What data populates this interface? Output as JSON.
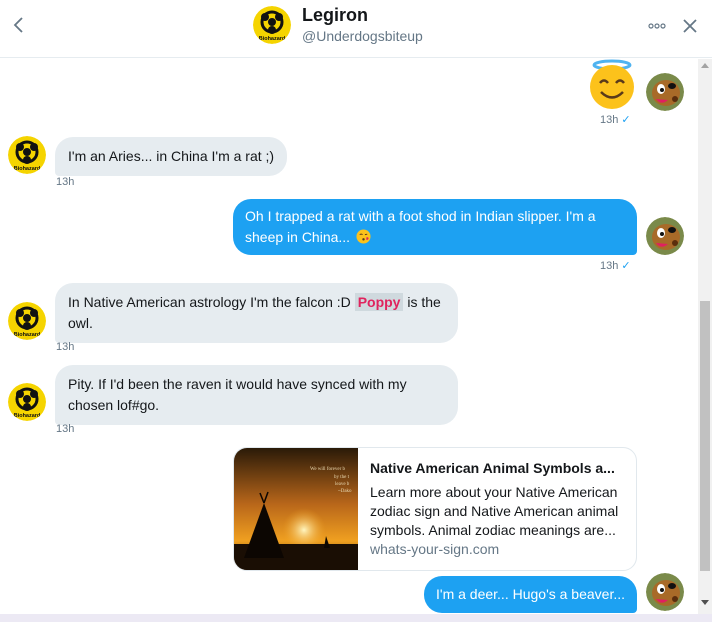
{
  "header": {
    "back_icon": "chevron-left-icon",
    "name": "Legiron",
    "handle": "@Underdogsbiteup",
    "avatar_text": "Biohazard",
    "more_icon": "more-dots-icon",
    "close_icon": "close-icon"
  },
  "messages": [
    {
      "side": "out",
      "content": "angel-smiley-emoji",
      "time": "13h",
      "status": "✓"
    },
    {
      "side": "in",
      "text": "I'm an Aries... in China I'm a rat ;)",
      "time": "13h"
    },
    {
      "side": "out",
      "text": "Oh I trapped a rat with a foot shod in Indian slipper. I'm a sheep in China...",
      "emoji": "kissing-face-emoji",
      "time": "13h",
      "status": "✓"
    },
    {
      "side": "in",
      "text_before": "In Native American astrology I'm the falcon :D",
      "mention": "Poppy",
      "text_after": "is the owl.",
      "time": "13h"
    },
    {
      "side": "in",
      "text": "Pity. If I'd been the raven it would have synced with my chosen lof#go.",
      "time": "13h"
    },
    {
      "side": "out",
      "card": {
        "title": "Native American Animal Symbols a...",
        "description": "Learn more about your Native American zodiac sign and Native American animal symbols. Animal zodiac meanings are...",
        "domain": "whats-your-sign.com",
        "image_text_1": "We will forever b",
        "image_text_2": "by the t",
        "image_text_3": "leave b",
        "image_text_4": "~Dako"
      }
    },
    {
      "side": "out",
      "text": "I'm a deer... Hugo's a beaver..."
    }
  ],
  "colors": {
    "accent": "#1da1f2",
    "incoming_bubble": "#e6ecf0",
    "mention": "#e0245e",
    "muted": "#657786"
  }
}
